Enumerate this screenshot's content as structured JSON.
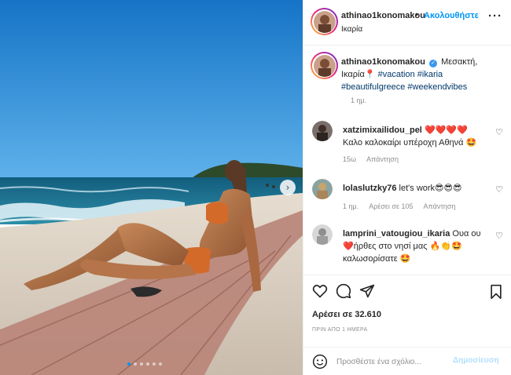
{
  "post_author": {
    "username": "athinao1konomakou",
    "follow_label": "Ακολουθήστε",
    "separator": "•",
    "location": "Ικαρία",
    "more_label": "···"
  },
  "caption": {
    "username": "athinao1konomakou",
    "verified_icon": "verified-check-icon",
    "text_before": "Μεσακτή, Ικαρία",
    "pin": "📍",
    "hashtags": [
      "#vacation",
      "#ikaria",
      "#beautifulgreece",
      "#weekendvibes"
    ],
    "time": "1 ημ."
  },
  "comments": [
    {
      "username": "xatzimixailidou_pel",
      "text_emoji_prefix": "❤️❤️❤️❤️",
      "text": "Καλο καλοκαίρι υπέροχη Αθηνά",
      "text_emoji_suffix": "🤩",
      "time": "15ω",
      "likes": "",
      "reply_label": "Απάντηση"
    },
    {
      "username": "lolaslutzky76",
      "text": "let's work",
      "text_emoji_suffix": "😎😎😎",
      "time": "1 ημ.",
      "likes": "Αρέσει σε 105",
      "reply_label": "Απάντηση"
    },
    {
      "username": "lamprini_vatougiou_ikaria",
      "text": "Ουα ου",
      "text_emoji_mid": "❤️",
      "text2": "ήρθες στο νησί μας",
      "text_emoji_mid2": "🔥👏🤩",
      "text3": "καλωσορίσατε",
      "text_emoji_suffix": "🤩"
    }
  ],
  "actions": {
    "likes": "Αρέσει σε 32.610",
    "posted": "ΠΡΙΝ ΑΠΟ 1 ΗΜΕΡΑ"
  },
  "add_comment": {
    "placeholder": "Προσθέστε ένα σχόλιο...",
    "post_label": "Δημοσίευση"
  },
  "carousel": {
    "dot_count": 6,
    "active_index": 0
  },
  "colors": {
    "accent": "#0095f6",
    "sky": "#1f86d6",
    "sea": "#1c6f8f",
    "sand": "#d9cfc3"
  }
}
